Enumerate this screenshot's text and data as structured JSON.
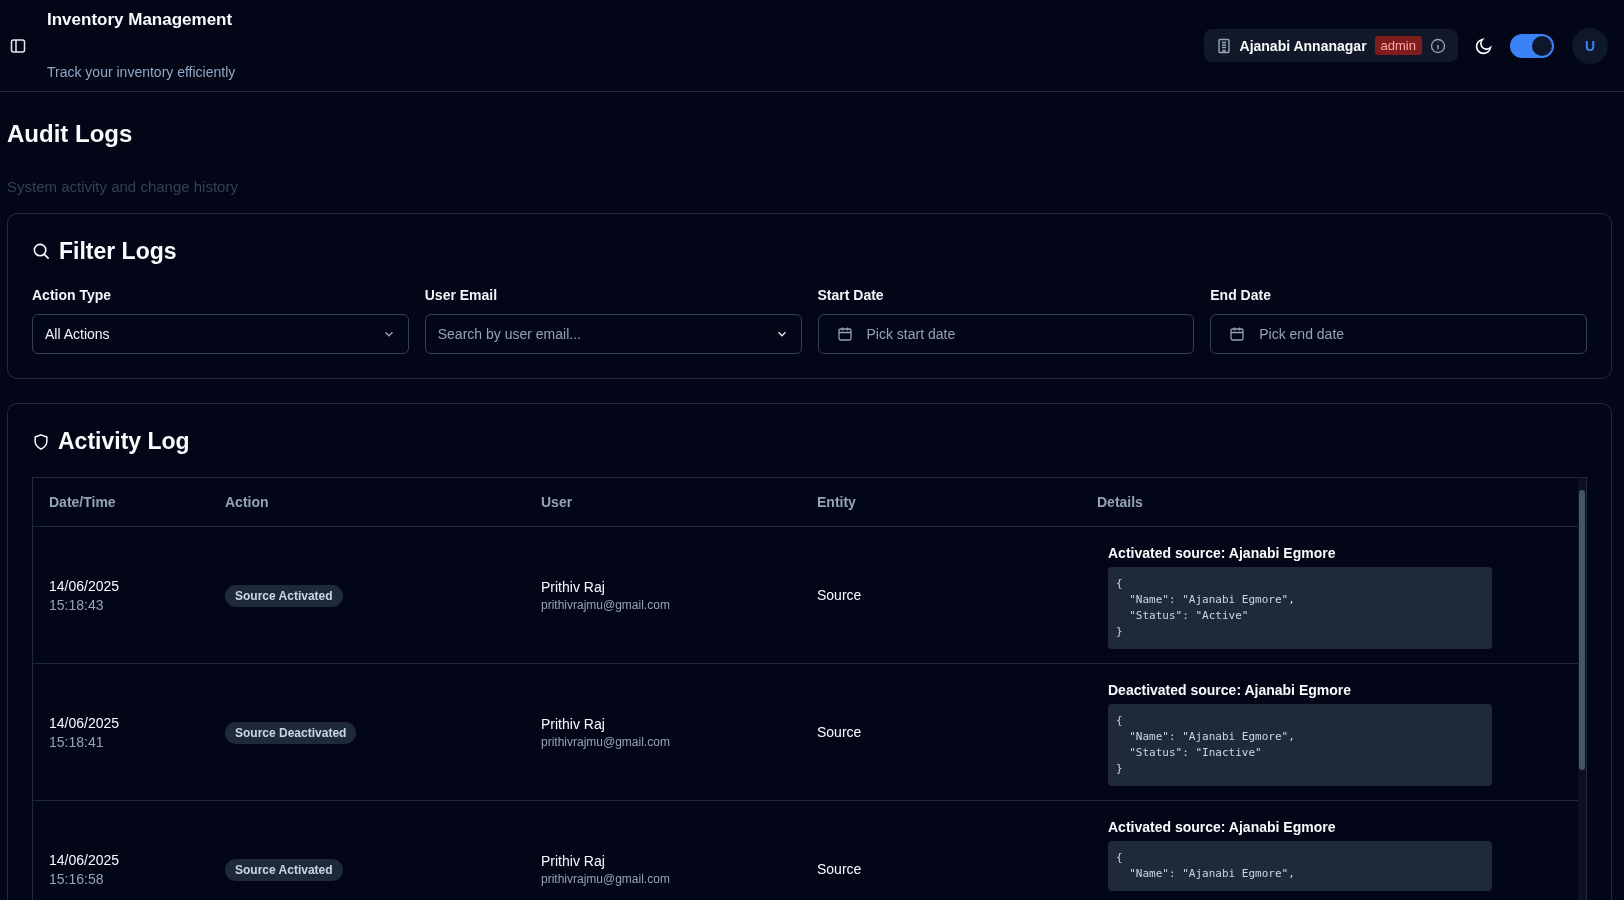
{
  "header": {
    "title": "Inventory Management",
    "subtitle": "Track your inventory efficiently",
    "location": "Ajanabi Annanagar",
    "role": "admin",
    "dark_mode": {
      "on": true
    },
    "avatar": "U"
  },
  "page": {
    "title": "Audit Logs",
    "subtitle": "System activity and change history"
  },
  "filters": {
    "title": "Filter Logs",
    "fields": [
      {
        "kind": "select",
        "label": "Action Type",
        "value": "All Actions"
      },
      {
        "kind": "combobox",
        "label": "User Email",
        "placeholder": "Search by user email..."
      },
      {
        "kind": "date",
        "label": "Start Date",
        "placeholder": "Pick start date"
      },
      {
        "kind": "date",
        "label": "End Date",
        "placeholder": "Pick end date"
      }
    ]
  },
  "activity": {
    "title": "Activity Log",
    "columns": [
      "Date/Time",
      "Action",
      "User",
      "Entity",
      "Details"
    ],
    "rows": [
      {
        "date": "14/06/2025",
        "time": "15:18:43",
        "action": "Source Activated",
        "user": "Prithiv Raj",
        "email": "prithivrajmu@gmail.com",
        "entity": "Source",
        "details_title": "Activated source: Ajanabi Egmore",
        "details_json": "{\n  \"Name\": \"Ajanabi Egmore\",\n  \"Status\": \"Active\"\n}"
      },
      {
        "date": "14/06/2025",
        "time": "15:18:41",
        "action": "Source Deactivated",
        "user": "Prithiv Raj",
        "email": "prithivrajmu@gmail.com",
        "entity": "Source",
        "details_title": "Deactivated source: Ajanabi Egmore",
        "details_json": "{\n  \"Name\": \"Ajanabi Egmore\",\n  \"Status\": \"Inactive\"\n}"
      },
      {
        "date": "14/06/2025",
        "time": "15:16:58",
        "action": "Source Activated",
        "user": "Prithiv Raj",
        "email": "prithivrajmu@gmail.com",
        "entity": "Source",
        "details_title": "Activated source: Ajanabi Egmore",
        "details_json": "{\n  \"Name\": \"Ajanabi Egmore\","
      }
    ]
  }
}
